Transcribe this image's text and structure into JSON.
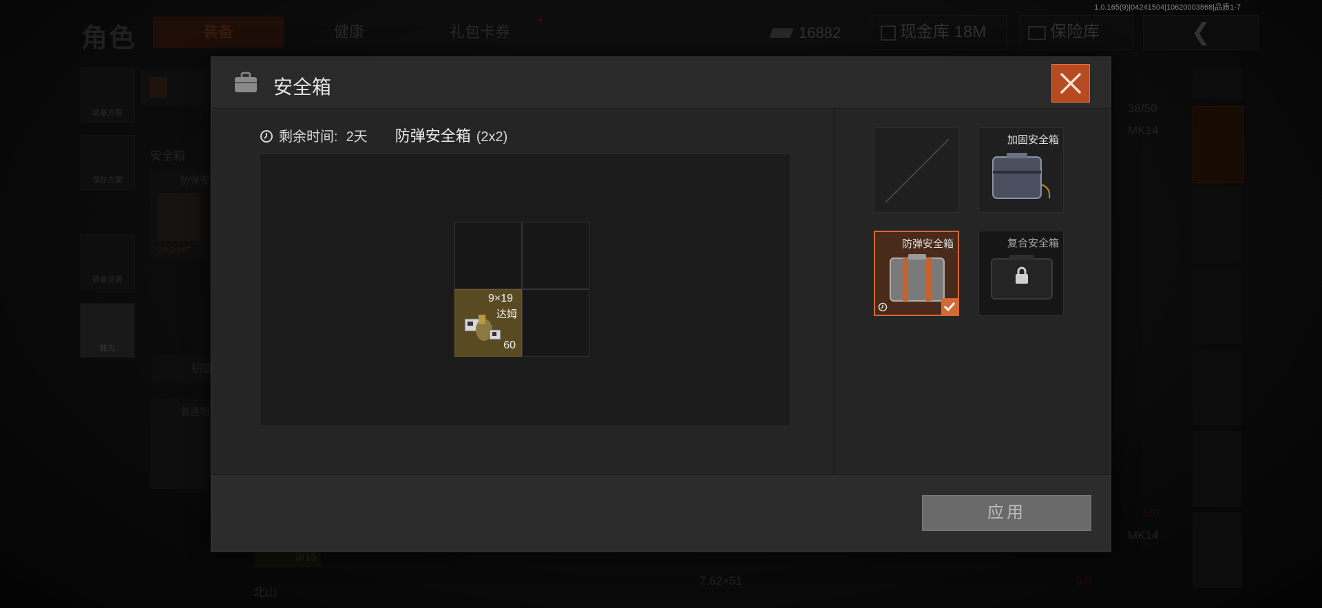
{
  "version_text": "1.0.165(9)|04241504|10620003868|品质1-7",
  "background": {
    "page_title": "角色",
    "tabs": [
      {
        "label": "装备",
        "active": true
      },
      {
        "label": "健康",
        "active": false
      },
      {
        "label": "礼包卡券",
        "active": false
      }
    ],
    "currency_value": "16882",
    "cash_vault_label": "现金库 18M",
    "safe_vault_label": "保险库",
    "back_icon": "chevron-left-icon",
    "left_sidebar": [
      {
        "label": "装备方案",
        "icon": "vest-icon"
      },
      {
        "label": "保存方案",
        "icon": "download-icon"
      },
      {
        "label": "装备涂装",
        "icon": "helmet-icon"
      },
      {
        "label": "能力",
        "icon": "lightning-gear-icon"
      }
    ],
    "section_label": "安全箱",
    "bg_case_label": "防弹安",
    "bg_case_timer": "2天2小时",
    "key_label": "钥匙",
    "normal_label": "普通钥",
    "ammo_count_left": "9/15",
    "ammo_caliber": "7.62×51",
    "map_label": "北山",
    "right_counts": [
      "38/50",
      "MK14",
      "6/6",
      "MK14",
      "0/0"
    ]
  },
  "modal": {
    "title": "安全箱",
    "icon": "briefcase-icon",
    "remaining_label": "剩余时间:",
    "remaining_value": "2天",
    "case_name": "防弹安全箱",
    "case_size": "(2x2)",
    "item": {
      "caliber": "9×19",
      "name": "达姆",
      "count": "60"
    },
    "options": [
      {
        "label": "",
        "state": "empty"
      },
      {
        "label": "加固安全箱",
        "state": "available"
      },
      {
        "label": "防弹安全箱",
        "state": "selected"
      },
      {
        "label": "复合安全箱",
        "state": "locked"
      }
    ],
    "apply_label": "应用",
    "colors": {
      "accent": "#d26a34",
      "close_bg": "#b84a22"
    }
  }
}
